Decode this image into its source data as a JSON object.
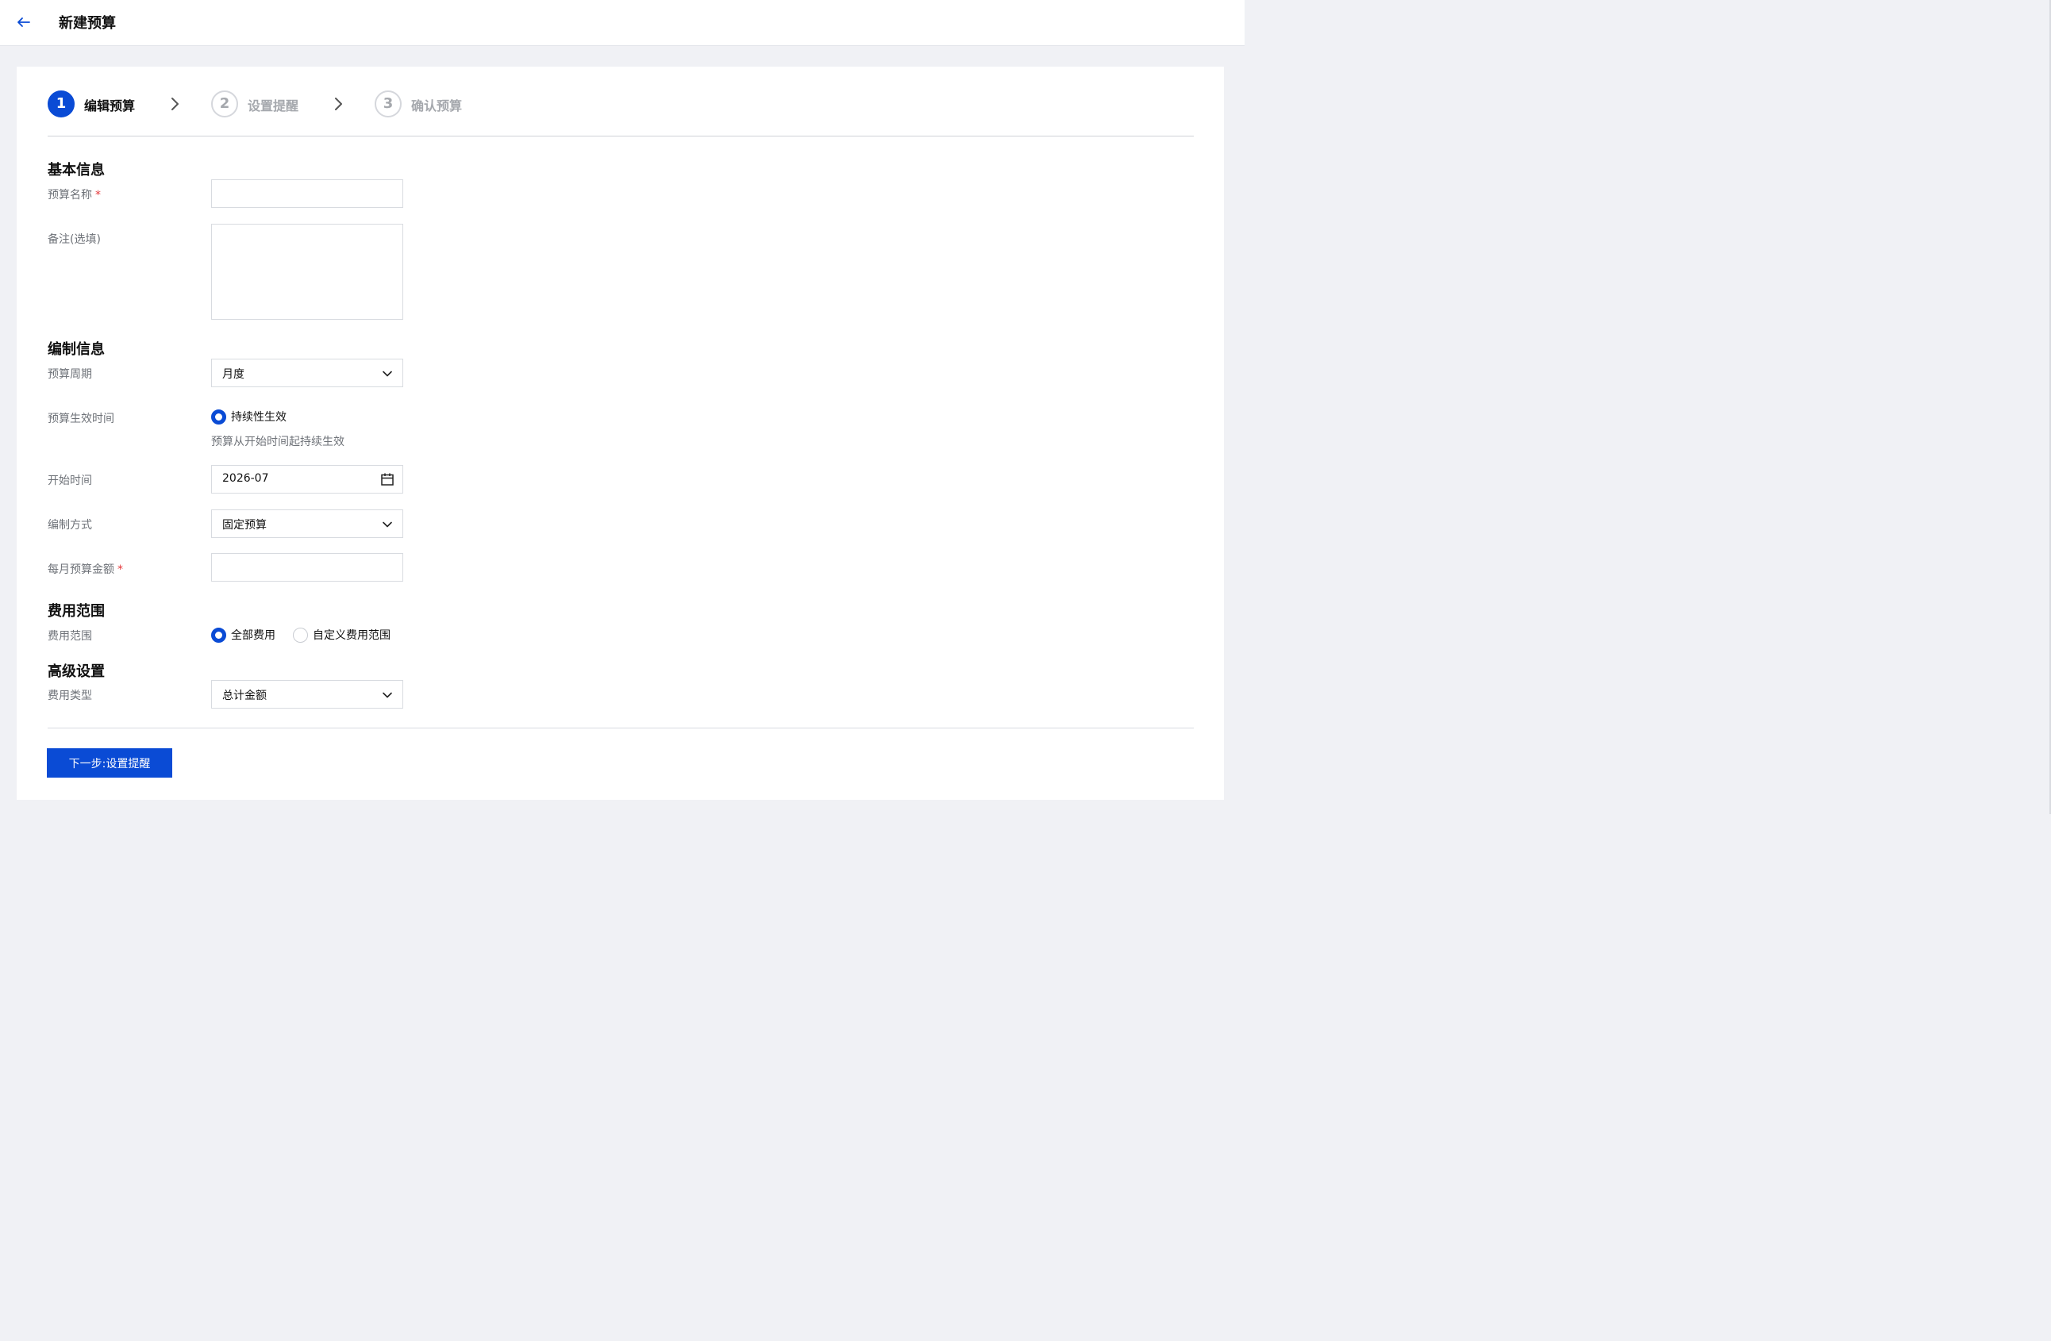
{
  "header": {
    "title": "新建预算",
    "back_icon": "arrow-left-icon"
  },
  "steps": [
    {
      "number": "1",
      "label": "编辑预算",
      "state": "active"
    },
    {
      "number": "2",
      "label": "设置提醒",
      "state": "inactive"
    },
    {
      "number": "3",
      "label": "确认预算",
      "state": "inactive"
    }
  ],
  "basic_info": {
    "title": "基本信息",
    "budget_name_label": "预算名称",
    "required_mark": "*",
    "budget_name_value": "",
    "remark_label": "备注(选填)",
    "remark_value": ""
  },
  "compile_info": {
    "title": "编制信息",
    "cycle_label": "预算周期",
    "cycle_value": "月度",
    "effective_label": "预算生效时间",
    "effective_option": "持续性生效",
    "effective_hint": "预算从开始时间起持续生效",
    "start_label": "开始时间",
    "start_value": "2026-07",
    "method_label": "编制方式",
    "method_value": "固定预算",
    "monthly_amount_label": "每月预算金额",
    "required_mark": "*",
    "monthly_amount_value": ""
  },
  "cost_scope": {
    "title": "费用范围",
    "label": "费用范围",
    "options": [
      {
        "label": "全部费用",
        "checked": true
      },
      {
        "label": "自定义费用范围",
        "checked": false
      }
    ]
  },
  "advanced": {
    "title": "高级设置",
    "cost_type_label": "费用类型",
    "cost_type_value": "总计金额"
  },
  "footer": {
    "next_button": "下一步:设置提醒"
  },
  "colors": {
    "accent": "#0a4bd5",
    "required": "#e5383b",
    "background": "#f0f1f5"
  }
}
